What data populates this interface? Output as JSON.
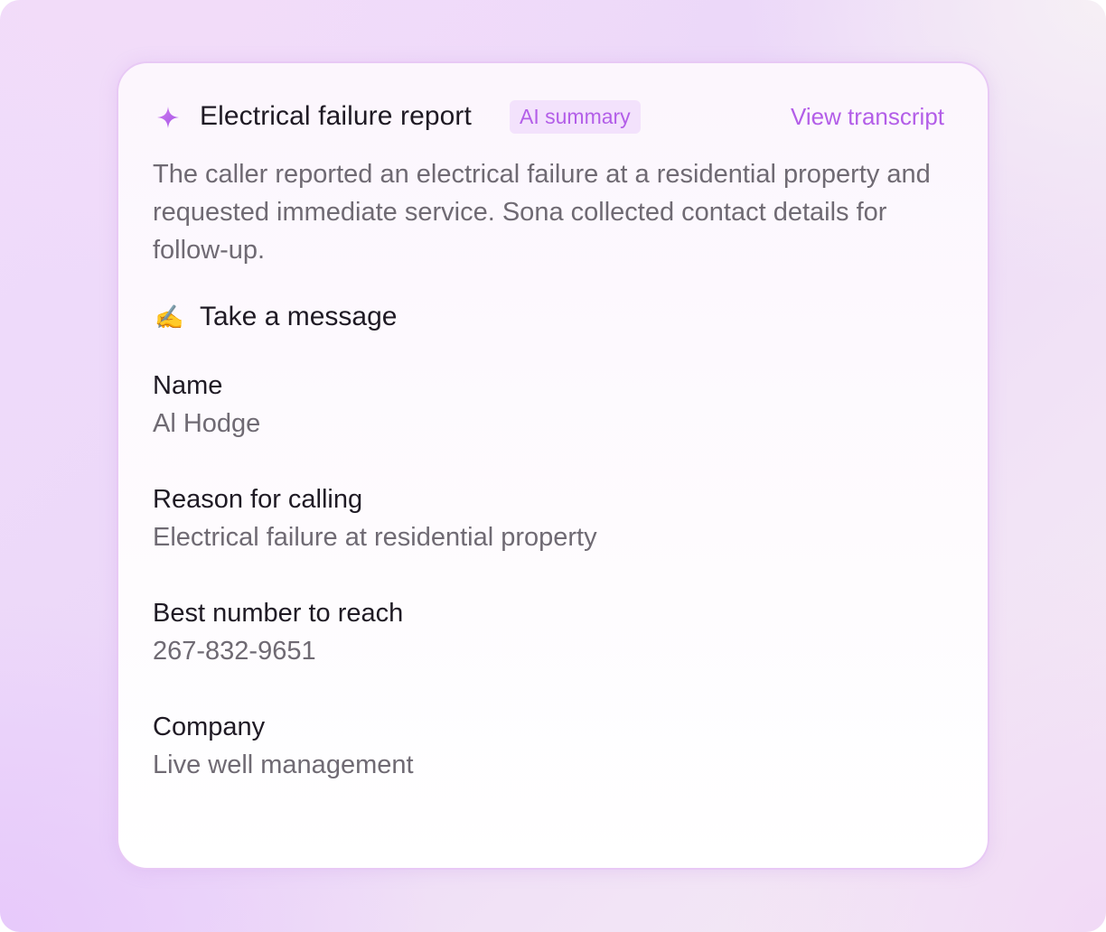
{
  "header": {
    "title": "Electrical failure report",
    "badge": "AI summary",
    "link": "View transcript",
    "icon": "sparkle-icon"
  },
  "summary": "The caller reported an electrical failure at a residential property and requested immediate service. Sona collected contact details for follow-up.",
  "section": {
    "emoji": "✍️",
    "title": "Take a message"
  },
  "fields": [
    {
      "label": "Name",
      "value": "Al Hodge"
    },
    {
      "label": "Reason for calling",
      "value": "Electrical failure at residential property"
    },
    {
      "label": "Best number to reach",
      "value": "267-832-9651"
    },
    {
      "label": "Company",
      "value": "Live well management"
    }
  ],
  "colors": {
    "accent": "#b35ee8",
    "badge_bg": "#f3e2fc",
    "text_primary": "#1f1a24",
    "text_secondary": "#6f6a73"
  }
}
